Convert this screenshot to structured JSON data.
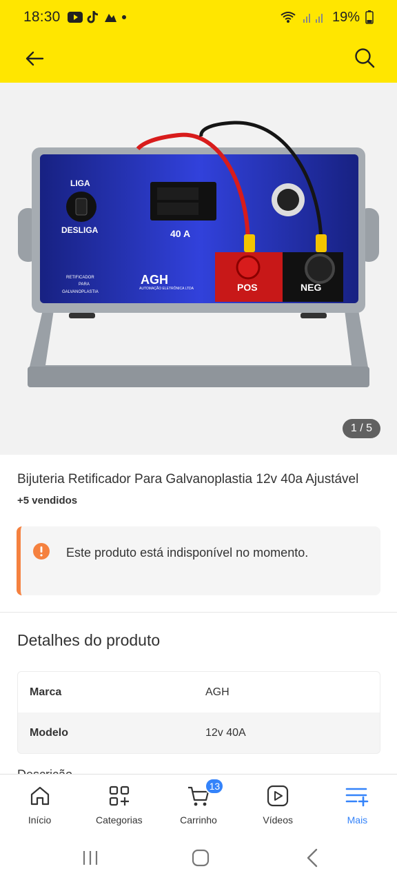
{
  "status_bar": {
    "time": "18:30",
    "battery": "19%",
    "icons": [
      "youtube-icon",
      "tiktok-icon",
      "app-icon",
      "dot-icon",
      "wifi-icon",
      "signal-icon",
      "battery-icon"
    ]
  },
  "header": {
    "back_icon": "arrow-left-icon",
    "search_icon": "search-icon",
    "background": "#ffe600"
  },
  "gallery": {
    "counter": "1 / 5",
    "image_labels": {
      "liga": "LIGA",
      "desliga": "DESLIGA",
      "amps": "40 A",
      "pos": "POS",
      "neg": "NEG",
      "brand": "AGH",
      "brand_sub": "AUTOMAÇÃO ELETRÔNICA LTDA",
      "retificador": "RETIFICADOR",
      "para": "PARA",
      "galvanoplastia": "GALVANOPLASTIA"
    }
  },
  "product": {
    "title": "Bijuteria Retificador Para Galvanoplastia 12v 40a Ajustável",
    "sold": "+5 vendidos"
  },
  "notice": {
    "text": "Este produto está indisponível no momento.",
    "accent": "#f5813f"
  },
  "details": {
    "title": "Detalhes do produto",
    "rows": [
      {
        "label": "Marca",
        "value": "AGH"
      },
      {
        "label": "Modelo",
        "value": "12v 40A"
      }
    ],
    "next_section_peek": "Descrição"
  },
  "bottom_nav": {
    "items": [
      {
        "label": "Início",
        "icon": "home-icon"
      },
      {
        "label": "Categorias",
        "icon": "categories-icon"
      },
      {
        "label": "Carrinho",
        "icon": "cart-icon",
        "badge": "13"
      },
      {
        "label": "Vídeos",
        "icon": "video-icon"
      },
      {
        "label": "Mais",
        "icon": "menu-more-icon",
        "active": true
      }
    ],
    "active_color": "#3483fa"
  },
  "system_nav": {
    "icons": [
      "recents-icon",
      "home-button-icon",
      "back-button-icon"
    ]
  }
}
